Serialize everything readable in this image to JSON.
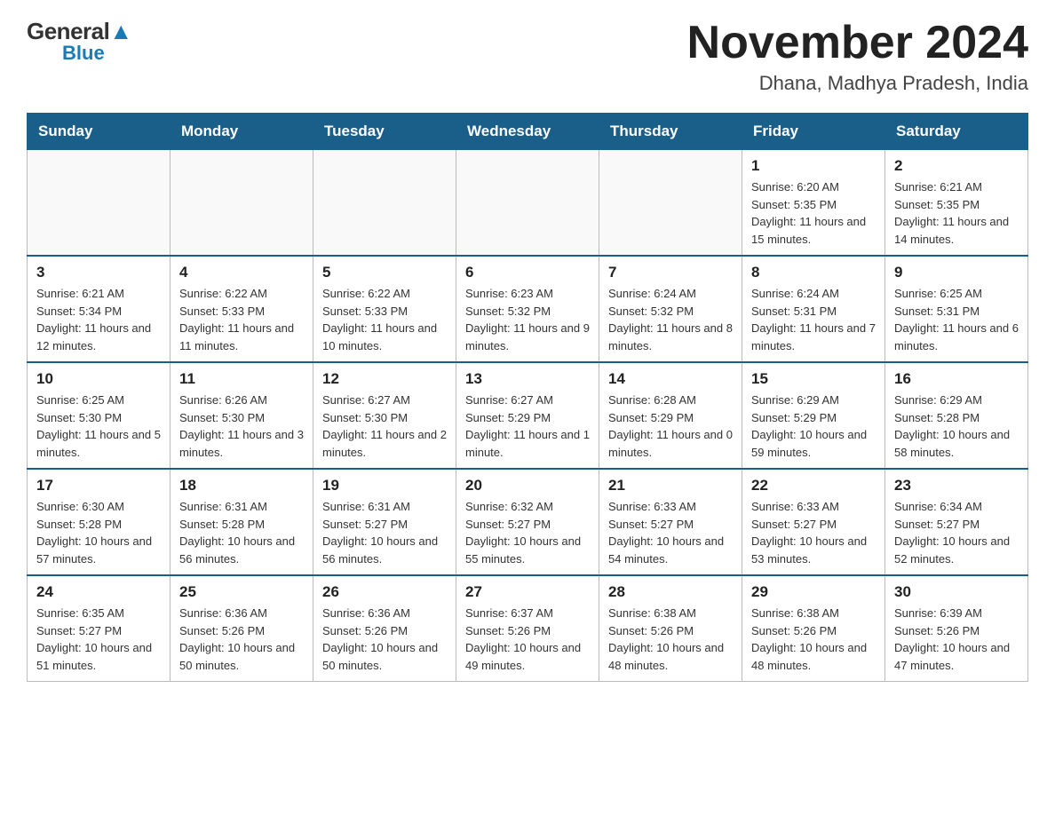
{
  "logo": {
    "general": "General",
    "blue_text": "Blue",
    "triangle_label": "logo-triangle"
  },
  "title": "November 2024",
  "subtitle": "Dhana, Madhya Pradesh, India",
  "days_of_week": [
    "Sunday",
    "Monday",
    "Tuesday",
    "Wednesday",
    "Thursday",
    "Friday",
    "Saturday"
  ],
  "weeks": [
    [
      {
        "day": "",
        "info": ""
      },
      {
        "day": "",
        "info": ""
      },
      {
        "day": "",
        "info": ""
      },
      {
        "day": "",
        "info": ""
      },
      {
        "day": "",
        "info": ""
      },
      {
        "day": "1",
        "info": "Sunrise: 6:20 AM\nSunset: 5:35 PM\nDaylight: 11 hours and 15 minutes."
      },
      {
        "day": "2",
        "info": "Sunrise: 6:21 AM\nSunset: 5:35 PM\nDaylight: 11 hours and 14 minutes."
      }
    ],
    [
      {
        "day": "3",
        "info": "Sunrise: 6:21 AM\nSunset: 5:34 PM\nDaylight: 11 hours and 12 minutes."
      },
      {
        "day": "4",
        "info": "Sunrise: 6:22 AM\nSunset: 5:33 PM\nDaylight: 11 hours and 11 minutes."
      },
      {
        "day": "5",
        "info": "Sunrise: 6:22 AM\nSunset: 5:33 PM\nDaylight: 11 hours and 10 minutes."
      },
      {
        "day": "6",
        "info": "Sunrise: 6:23 AM\nSunset: 5:32 PM\nDaylight: 11 hours and 9 minutes."
      },
      {
        "day": "7",
        "info": "Sunrise: 6:24 AM\nSunset: 5:32 PM\nDaylight: 11 hours and 8 minutes."
      },
      {
        "day": "8",
        "info": "Sunrise: 6:24 AM\nSunset: 5:31 PM\nDaylight: 11 hours and 7 minutes."
      },
      {
        "day": "9",
        "info": "Sunrise: 6:25 AM\nSunset: 5:31 PM\nDaylight: 11 hours and 6 minutes."
      }
    ],
    [
      {
        "day": "10",
        "info": "Sunrise: 6:25 AM\nSunset: 5:30 PM\nDaylight: 11 hours and 5 minutes."
      },
      {
        "day": "11",
        "info": "Sunrise: 6:26 AM\nSunset: 5:30 PM\nDaylight: 11 hours and 3 minutes."
      },
      {
        "day": "12",
        "info": "Sunrise: 6:27 AM\nSunset: 5:30 PM\nDaylight: 11 hours and 2 minutes."
      },
      {
        "day": "13",
        "info": "Sunrise: 6:27 AM\nSunset: 5:29 PM\nDaylight: 11 hours and 1 minute."
      },
      {
        "day": "14",
        "info": "Sunrise: 6:28 AM\nSunset: 5:29 PM\nDaylight: 11 hours and 0 minutes."
      },
      {
        "day": "15",
        "info": "Sunrise: 6:29 AM\nSunset: 5:29 PM\nDaylight: 10 hours and 59 minutes."
      },
      {
        "day": "16",
        "info": "Sunrise: 6:29 AM\nSunset: 5:28 PM\nDaylight: 10 hours and 58 minutes."
      }
    ],
    [
      {
        "day": "17",
        "info": "Sunrise: 6:30 AM\nSunset: 5:28 PM\nDaylight: 10 hours and 57 minutes."
      },
      {
        "day": "18",
        "info": "Sunrise: 6:31 AM\nSunset: 5:28 PM\nDaylight: 10 hours and 56 minutes."
      },
      {
        "day": "19",
        "info": "Sunrise: 6:31 AM\nSunset: 5:27 PM\nDaylight: 10 hours and 56 minutes."
      },
      {
        "day": "20",
        "info": "Sunrise: 6:32 AM\nSunset: 5:27 PM\nDaylight: 10 hours and 55 minutes."
      },
      {
        "day": "21",
        "info": "Sunrise: 6:33 AM\nSunset: 5:27 PM\nDaylight: 10 hours and 54 minutes."
      },
      {
        "day": "22",
        "info": "Sunrise: 6:33 AM\nSunset: 5:27 PM\nDaylight: 10 hours and 53 minutes."
      },
      {
        "day": "23",
        "info": "Sunrise: 6:34 AM\nSunset: 5:27 PM\nDaylight: 10 hours and 52 minutes."
      }
    ],
    [
      {
        "day": "24",
        "info": "Sunrise: 6:35 AM\nSunset: 5:27 PM\nDaylight: 10 hours and 51 minutes."
      },
      {
        "day": "25",
        "info": "Sunrise: 6:36 AM\nSunset: 5:26 PM\nDaylight: 10 hours and 50 minutes."
      },
      {
        "day": "26",
        "info": "Sunrise: 6:36 AM\nSunset: 5:26 PM\nDaylight: 10 hours and 50 minutes."
      },
      {
        "day": "27",
        "info": "Sunrise: 6:37 AM\nSunset: 5:26 PM\nDaylight: 10 hours and 49 minutes."
      },
      {
        "day": "28",
        "info": "Sunrise: 6:38 AM\nSunset: 5:26 PM\nDaylight: 10 hours and 48 minutes."
      },
      {
        "day": "29",
        "info": "Sunrise: 6:38 AM\nSunset: 5:26 PM\nDaylight: 10 hours and 48 minutes."
      },
      {
        "day": "30",
        "info": "Sunrise: 6:39 AM\nSunset: 5:26 PM\nDaylight: 10 hours and 47 minutes."
      }
    ]
  ]
}
